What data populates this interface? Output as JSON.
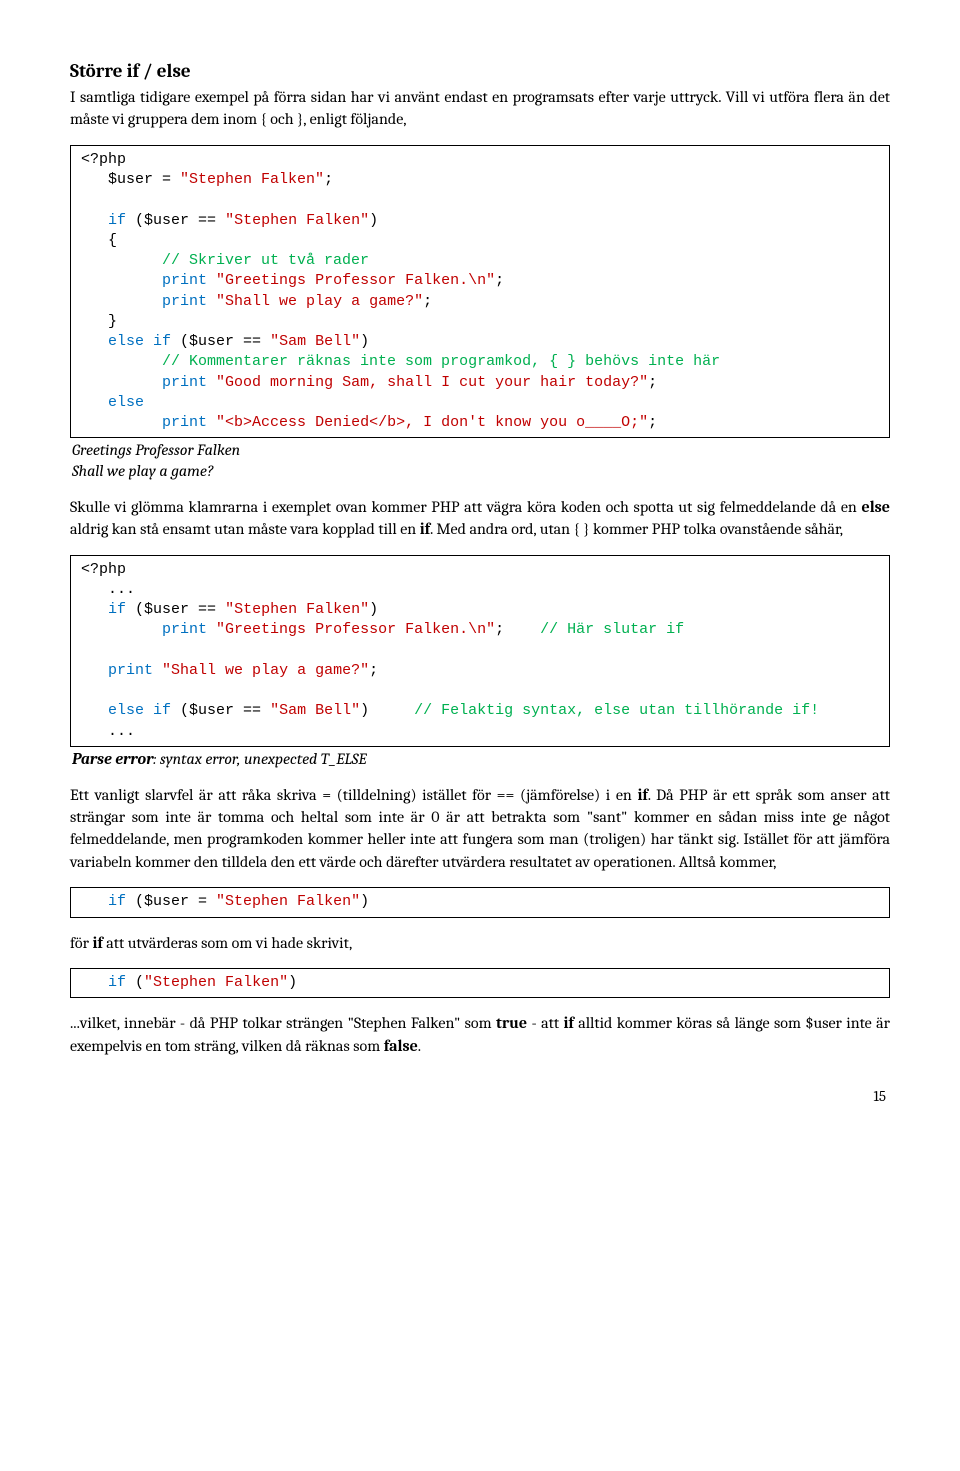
{
  "title": "Större if / else",
  "intro": "I samtliga tidigare exempel på förra sidan har vi använt endast en programsats efter varje uttryck. Vill vi utföra flera än det måste vi gruppera dem inom { och }, enligt följande,",
  "code1": {
    "l1a": "<?php",
    "l2a": "   $user = ",
    "l2b": "\"Stephen Falken\"",
    "l2c": ";",
    "l3a": "   ",
    "l3b": "if",
    "l3c": " ($user == ",
    "l3d": "\"Stephen Falken\"",
    "l3e": ")",
    "l4a": "   {",
    "l5a": "         ",
    "l5b": "// Skriver ut två rader",
    "l6a": "         ",
    "l6b": "print",
    "l6c": " ",
    "l6d": "\"Greetings Professor Falken.\\n\"",
    "l6e": ";",
    "l7a": "         ",
    "l7b": "print",
    "l7c": " ",
    "l7d": "\"Shall we play a game?\"",
    "l7e": ";",
    "l8a": "   }",
    "l9a": "   ",
    "l9b": "else if",
    "l9c": " ($user == ",
    "l9d": "\"Sam Bell\"",
    "l9e": ")",
    "l10a": "         ",
    "l10b": "// Kommentarer räknas inte som programkod, { } behövs inte här",
    "l11a": "         ",
    "l11b": "print",
    "l11c": " ",
    "l11d": "\"Good morning Sam, shall I cut your hair today?\"",
    "l11e": ";",
    "l12a": "   ",
    "l12b": "else",
    "l13a": "         ",
    "l13b": "print",
    "l13c": " ",
    "l13d": "\"<b>Access Denied</b>, I don't know you o____O;\"",
    "l13e": ";"
  },
  "out1_l1": "Greetings Professor Falken",
  "out1_l2": "Shall we play a game?",
  "para2_a": "Skulle vi glömma klamrarna i exemplet ovan kommer PHP att vägra köra koden och spotta ut sig fel­meddelande då en ",
  "para2_b": "else",
  "para2_c": " aldrig kan stå ensamt utan måste vara kopplad till en ",
  "para2_d": "if",
  "para2_e": ". Med andra ord, utan { } kommer PHP tolka ovanstående såhär,",
  "code2": {
    "l1a": "<?php",
    "l2a": "   ...",
    "l3a": "   ",
    "l3b": "if",
    "l3c": " ($user == ",
    "l3d": "\"Stephen Falken\"",
    "l3e": ")",
    "l4a": "         ",
    "l4b": "print",
    "l4c": " ",
    "l4d": "\"Greetings Professor Falken.\\n\"",
    "l4e": ";    ",
    "l4f": "// Här slutar if",
    "l6a": "   ",
    "l6b": "print",
    "l6c": " ",
    "l6d": "\"Shall we play a game?\"",
    "l6e": ";",
    "l8a": "   ",
    "l8b": "else if",
    "l8c": " ($user == ",
    "l8d": "\"Sam Bell\"",
    "l8e": ")     ",
    "l8f": "// Felaktig syntax, else utan tillhörande if!",
    "l9a": "   ..."
  },
  "out2_a": "Parse error",
  "out2_b": ":  syntax error, unexpected T_ELSE",
  "para3_a": "Ett vanligt slarvfel är att råka skriva = (tilldelning) istället för == (jämförelse) i en ",
  "para3_b": "if",
  "para3_c": ". Då PHP är ett språk som anser att strängar som inte är tomma och heltal som inte är 0 är att betrakta som \"sant\" kommer en sådan miss inte ge något felmeddelande, men programkoden kommer heller inte att fungera som man (troligen) har tänkt sig. Istället för att jämföra variabeln kommer den tilldela den ett värde och därefter utvärdera resultatet av operationen. Alltså kommer,",
  "code3": {
    "l1a": "   ",
    "l1b": "if",
    "l1c": " ($user = ",
    "l1d": "\"Stephen Falken\"",
    "l1e": ")"
  },
  "para4_a": "för ",
  "para4_b": "if",
  "para4_c": " att utvärderas som om vi hade skrivit,",
  "code4": {
    "l1a": "   ",
    "l1b": "if",
    "l1c": " (",
    "l1d": "\"Stephen Falken\"",
    "l1e": ")"
  },
  "para5_a": "...vilket, innebär - då PHP tolkar strängen \"Stephen Falken\" som ",
  "para5_b": "true",
  "para5_c": " - att ",
  "para5_d": "if",
  "para5_e": " alltid kommer köras så länge som $user inte är exempelvis en tom sträng, vilken då räknas som ",
  "para5_f": "false",
  "para5_g": ".",
  "pagenum": "15"
}
